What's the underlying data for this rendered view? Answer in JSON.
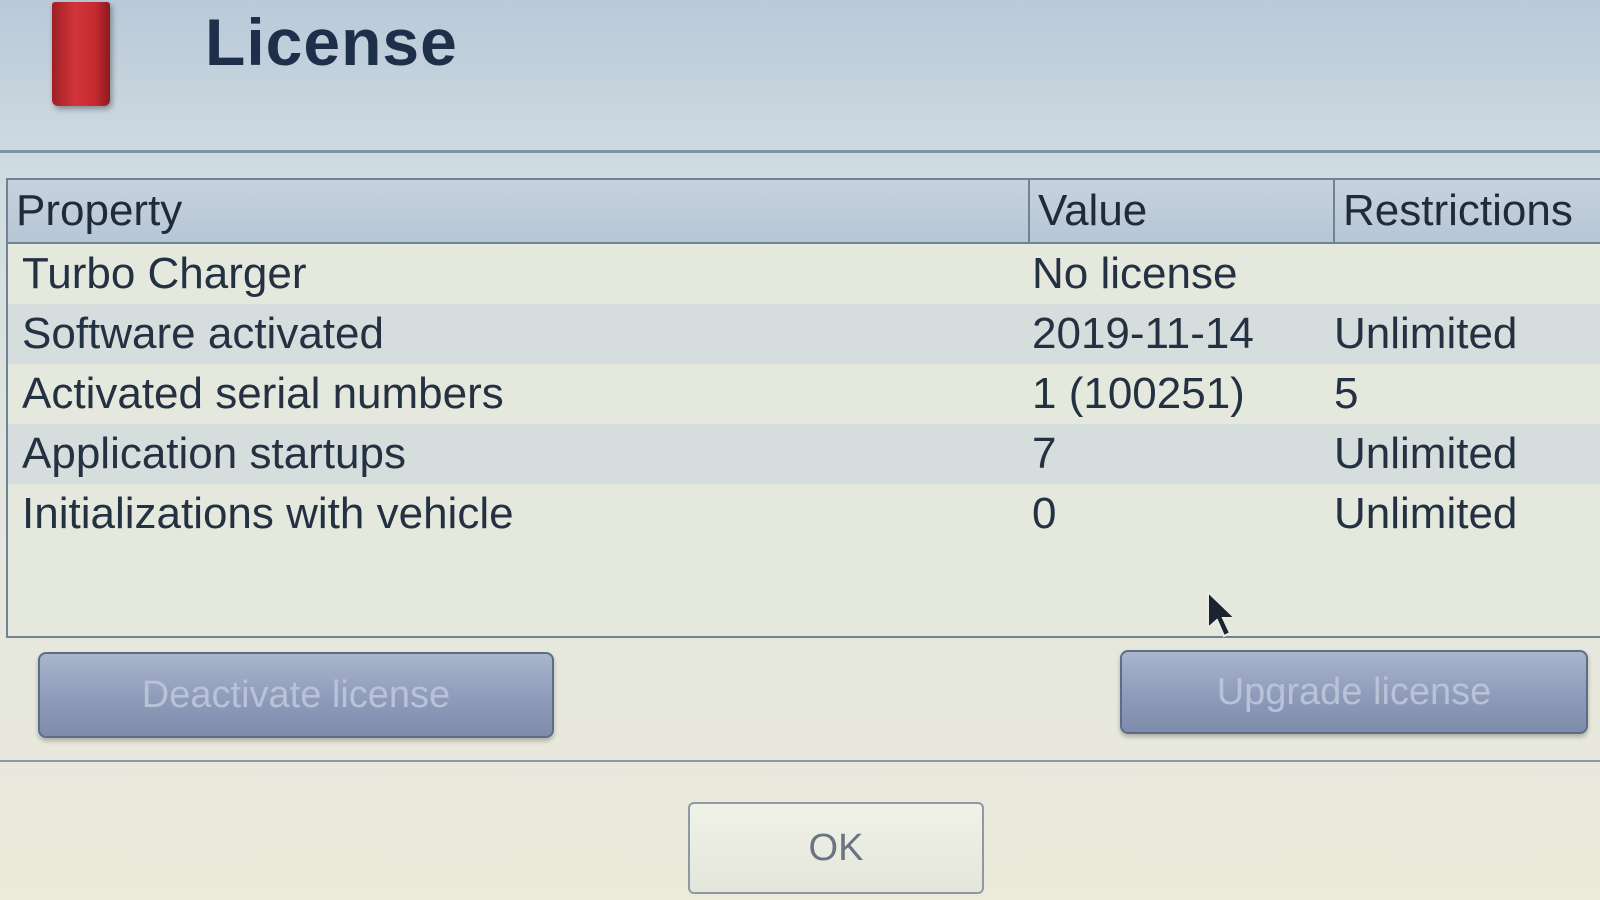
{
  "dialog": {
    "title": "License"
  },
  "table": {
    "columns": {
      "property": "Property",
      "value": "Value",
      "restrictions": "Restrictions"
    },
    "rows": [
      {
        "property": "Turbo Charger",
        "value": "No license",
        "restrictions": ""
      },
      {
        "property": "Software activated",
        "value": "2019-11-14",
        "restrictions": "Unlimited"
      },
      {
        "property": "Activated serial numbers",
        "value": "1 (100251)",
        "restrictions": "5"
      },
      {
        "property": "Application startups",
        "value": "7",
        "restrictions": "Unlimited"
      },
      {
        "property": "Initializations with vehicle",
        "value": "0",
        "restrictions": "Unlimited"
      }
    ]
  },
  "buttons": {
    "deactivate": "Deactivate license",
    "upgrade": "Upgrade license",
    "ok": "OK"
  },
  "colors": {
    "logo": "#c52a2f",
    "title": "#1e2f49",
    "button_fill": "#8e9bba"
  },
  "icons": {
    "cursor": "mouse-pointer-icon",
    "logo": "red-logo-block"
  }
}
